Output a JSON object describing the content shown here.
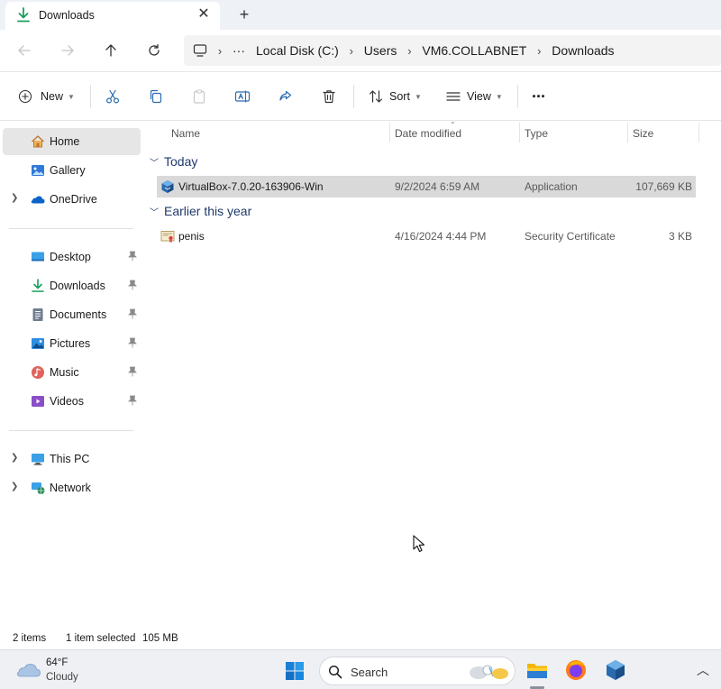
{
  "tab": {
    "title": "Downloads",
    "close": "✕",
    "new_tab": "+"
  },
  "breadcrumb": {
    "more": "···",
    "items": [
      "Local Disk (C:)",
      "Users",
      "VM6.COLLABNET",
      "Downloads"
    ]
  },
  "toolbar": {
    "new_label": "New",
    "sort_label": "Sort",
    "view_label": "View",
    "more_label": "···"
  },
  "sidebar": {
    "items": [
      {
        "label": "Home",
        "icon": "home-icon"
      },
      {
        "label": "Gallery",
        "icon": "gallery-icon"
      },
      {
        "label": "OneDrive",
        "icon": "onedrive-icon"
      },
      {
        "label": "Desktop",
        "icon": "desktop-icon"
      },
      {
        "label": "Downloads",
        "icon": "downloads-icon"
      },
      {
        "label": "Documents",
        "icon": "documents-icon"
      },
      {
        "label": "Pictures",
        "icon": "pictures-icon"
      },
      {
        "label": "Music",
        "icon": "music-icon"
      },
      {
        "label": "Videos",
        "icon": "videos-icon"
      },
      {
        "label": "This PC",
        "icon": "this-pc-icon"
      },
      {
        "label": "Network",
        "icon": "network-icon"
      }
    ]
  },
  "columns": {
    "name": "Name",
    "date": "Date modified",
    "type": "Type",
    "size": "Size"
  },
  "groups": [
    {
      "title": "Today",
      "files": [
        {
          "name": "VirtualBox-7.0.20-163906-Win",
          "date": "9/2/2024 6:59 AM",
          "type": "Application",
          "size": "107,669 KB",
          "icon": "virtualbox-icon",
          "selected": true
        }
      ]
    },
    {
      "title": "Earlier this year",
      "files": [
        {
          "name": "penis",
          "date": "4/16/2024 4:44 PM",
          "type": "Security Certificate",
          "size": "3 KB",
          "icon": "certificate-icon",
          "selected": false
        }
      ]
    }
  ],
  "status": {
    "items": "2 items",
    "selected": "1 item selected",
    "size": "105 MB"
  },
  "taskbar": {
    "weather_temp": "64°F",
    "weather_desc": "Cloudy",
    "search_label": "Search"
  },
  "colors": {
    "accent": "#0067c0",
    "selection": "#d9d9d9",
    "group_heading": "#1f3a6b",
    "folder_yellow": "#f2b600",
    "downloads_green": "#1a9e5a"
  }
}
